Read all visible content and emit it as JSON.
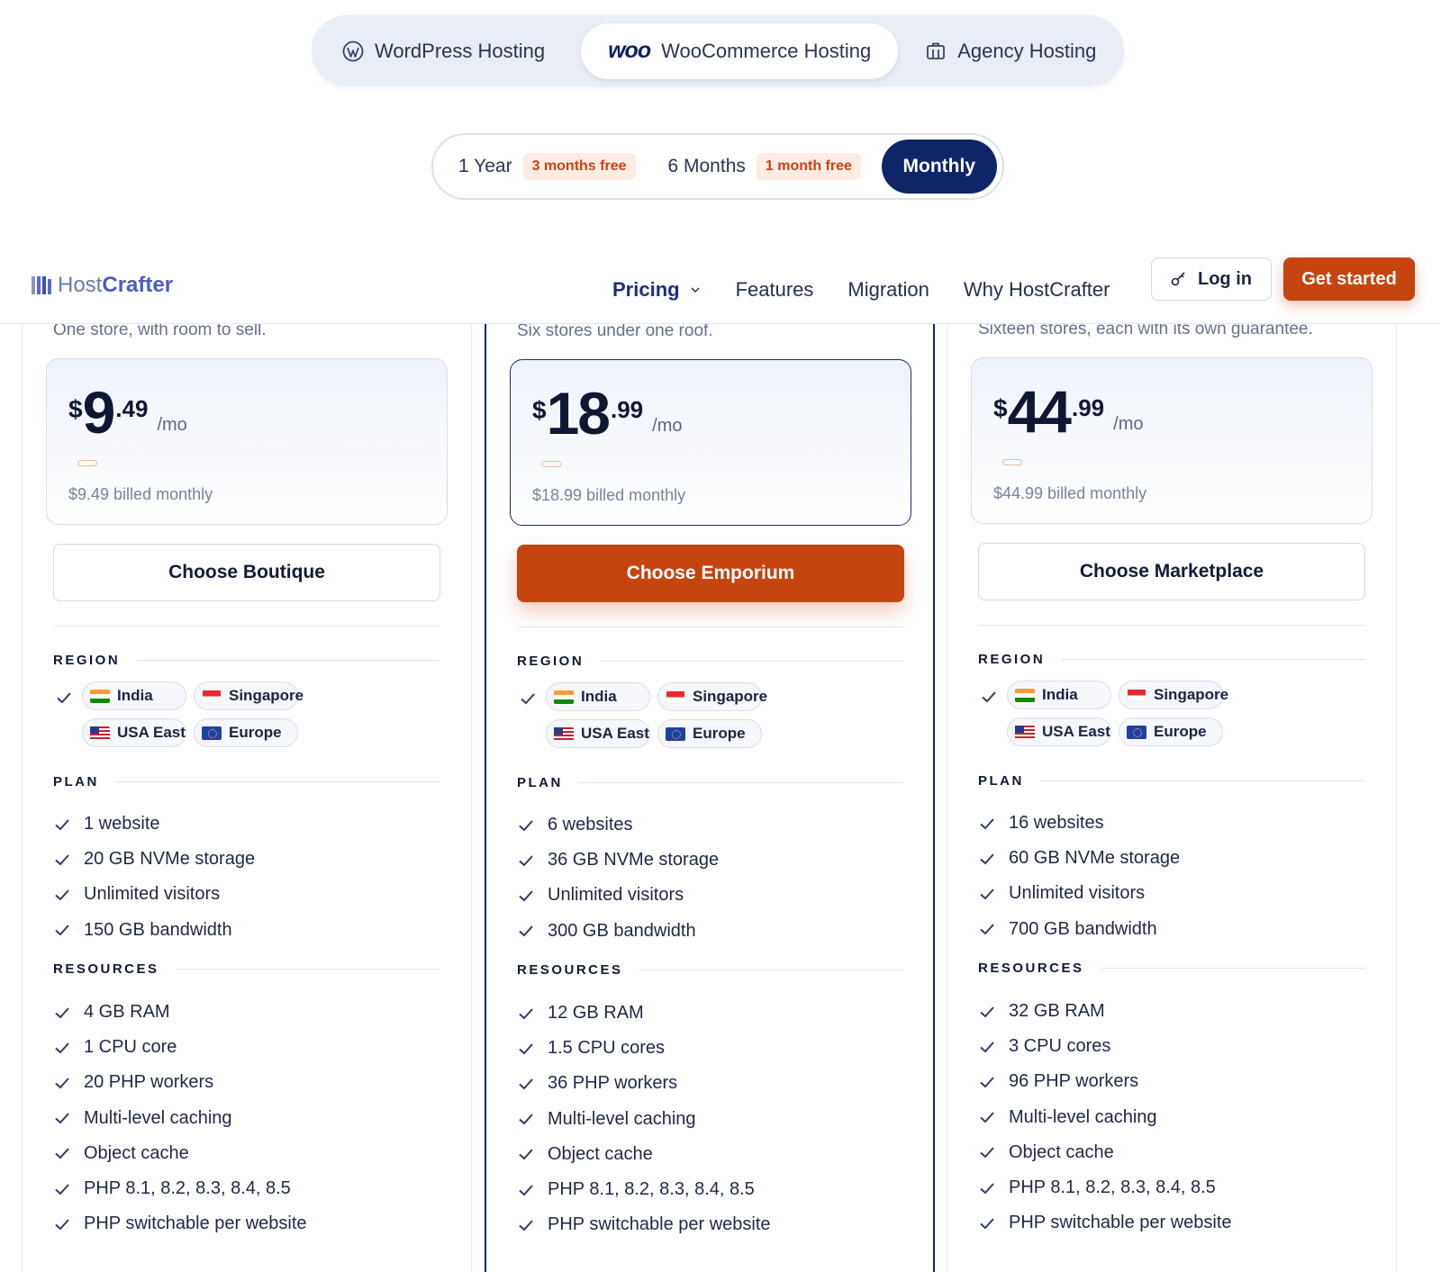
{
  "hosting_tabs": [
    {
      "label": "WordPress Hosting",
      "icon": "wordpress-icon",
      "active": false
    },
    {
      "label": "WooCommerce Hosting",
      "logo_text": "woo",
      "icon": "woo-logo",
      "active": true
    },
    {
      "label": "Agency Hosting",
      "icon": "building-icon",
      "active": false
    }
  ],
  "billing": {
    "year_label": "1 Year",
    "year_badge": "3 months free",
    "six_label": "6 Months",
    "six_badge": "1 month free",
    "monthly_label": "Monthly",
    "selected": "Monthly"
  },
  "nav": {
    "brand_host": "Host",
    "brand_crafter": "Crafter",
    "links": [
      "Pricing",
      "Features",
      "Migration",
      "Why HostCrafter"
    ],
    "active_link": "Pricing",
    "login_label": "Log in",
    "cta_label": "Get started"
  },
  "colors": {
    "accent": "#c5440f",
    "navy": "#0e2568",
    "badge_bg": "#fdece4"
  },
  "section_labels": {
    "region": "REGION",
    "plan": "PLAN",
    "resources": "RESOURCES"
  },
  "plans": [
    {
      "tagline": "One store, with room to sell.",
      "currency": "$",
      "price_int": "9",
      "price_dec": ".49",
      "per": "/mo",
      "billed": "$9.49 billed monthly",
      "cta": "Choose Boutique",
      "featured": false,
      "regions": [
        "India",
        "Singapore",
        "USA East",
        "Europe"
      ],
      "plan_features": [
        "1 website",
        "20 GB NVMe storage",
        "Unlimited visitors",
        "150 GB bandwidth"
      ],
      "resources": [
        "4 GB RAM",
        "1 CPU core",
        "20 PHP workers",
        "Multi-level caching",
        "Object cache",
        "PHP 8.1, 8.2, 8.3, 8.4, 8.5",
        "PHP switchable per website"
      ]
    },
    {
      "tagline": "Six stores under one roof.",
      "currency": "$",
      "price_int": "18",
      "price_dec": ".99",
      "per": "/mo",
      "billed": "$18.99 billed monthly",
      "cta": "Choose Emporium",
      "featured": true,
      "regions": [
        "India",
        "Singapore",
        "USA East",
        "Europe"
      ],
      "plan_features": [
        "6 websites",
        "36 GB NVMe storage",
        "Unlimited visitors",
        "300 GB bandwidth"
      ],
      "resources": [
        "12 GB RAM",
        "1.5 CPU cores",
        "36 PHP workers",
        "Multi-level caching",
        "Object cache",
        "PHP 8.1, 8.2, 8.3, 8.4, 8.5",
        "PHP switchable per website"
      ]
    },
    {
      "tagline": "Sixteen stores, each with its own guarantee.",
      "currency": "$",
      "price_int": "44",
      "price_dec": ".99",
      "per": "/mo",
      "billed": "$44.99 billed monthly",
      "cta": "Choose Marketplace",
      "featured": false,
      "regions": [
        "India",
        "Singapore",
        "USA East",
        "Europe"
      ],
      "plan_features": [
        "16 websites",
        "60 GB NVMe storage",
        "Unlimited visitors",
        "700 GB bandwidth"
      ],
      "resources": [
        "32 GB RAM",
        "3 CPU cores",
        "96 PHP workers",
        "Multi-level caching",
        "Object cache",
        "PHP 8.1, 8.2, 8.3, 8.4, 8.5",
        "PHP switchable per website"
      ]
    }
  ]
}
